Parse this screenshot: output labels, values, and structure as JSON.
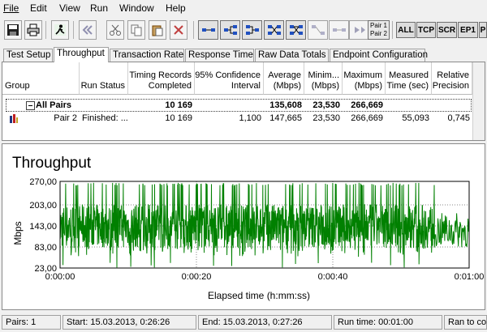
{
  "menu": [
    "File",
    "Edit",
    "View",
    "Run",
    "Window",
    "Help"
  ],
  "toolbar": {
    "text_buttons": [
      "ALL",
      "TCP",
      "SCR",
      "EP1",
      "P"
    ],
    "pair_button": [
      "Pair 1",
      "Pair 2"
    ]
  },
  "tabs": [
    "Test Setup",
    "Throughput",
    "Transaction Rate",
    "Response Time",
    "Raw Data Totals",
    "Endpoint Configuration"
  ],
  "active_tab": "Throughput",
  "table": {
    "headers": [
      [
        "Group"
      ],
      [
        "Run Status"
      ],
      [
        "Timing Records",
        "Completed"
      ],
      [
        "95% Confidence",
        "Interval"
      ],
      [
        "Average",
        "(Mbps)"
      ],
      [
        "Minim...",
        "(Mbps)"
      ],
      [
        "Maximum",
        "(Mbps)"
      ],
      [
        "Measured",
        "Time (sec)"
      ],
      [
        "Relative",
        "Precision"
      ]
    ],
    "all_pairs": {
      "group": "All Pairs",
      "records": "10 169",
      "average": "135,608",
      "minimum": "23,530",
      "maximum": "266,669"
    },
    "pair2": {
      "group": "Pair 2",
      "status": "Finished: ...",
      "records": "10 169",
      "confidence": "1,100",
      "average": "147,665",
      "minimum": "23,530",
      "maximum": "266,669",
      "time": "55,093",
      "precision": "0,745"
    }
  },
  "chart_data": {
    "type": "line",
    "title": "Throughput",
    "xlabel": "Elapsed time (h:mm:ss)",
    "ylabel": "Mbps",
    "ylim": [
      23,
      270
    ],
    "xlim": [
      0,
      60
    ],
    "yticks": [
      "270,00",
      "203,00",
      "143,00",
      "83,00",
      "23,00"
    ],
    "ytick_values": [
      270,
      203,
      143,
      83,
      23
    ],
    "xticks": [
      "0:00:00",
      "0:00:20",
      "0:00:40",
      "0:01:00"
    ],
    "xtick_values": [
      0,
      20,
      40,
      60
    ],
    "grid": true,
    "color": "#008000",
    "series": [
      {
        "band_low": 80,
        "band_high": 205,
        "peak": 266,
        "min": 23.5,
        "x_end": 55
      }
    ]
  },
  "status": {
    "pairs": "Pairs: 1",
    "start": "Start: 15.03.2013, 0:26:26",
    "end": "End: 15.03.2013, 0:27:26",
    "runtime": "Run time: 00:01:00",
    "ran": "Ran to comp"
  }
}
